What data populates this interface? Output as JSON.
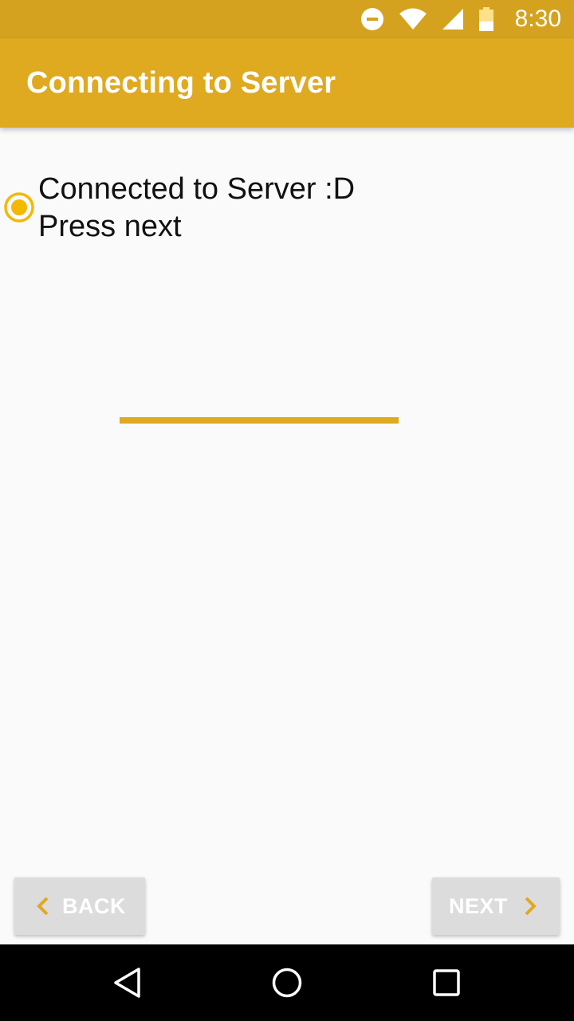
{
  "status_bar": {
    "time": "8:30",
    "icons": [
      "do-not-disturb-icon",
      "wifi-icon",
      "cellular-signal-icon",
      "battery-icon"
    ]
  },
  "app_bar": {
    "title": "Connecting to Server",
    "color": "#dfa920"
  },
  "main": {
    "status_line_1": "Connected to Server :D",
    "status_line_2": "Press next",
    "radio_selected": true,
    "accent_color": "#f5b800"
  },
  "footer": {
    "back_label": "BACK",
    "next_label": "NEXT",
    "back_icon": "chevron-left-icon",
    "next_icon": "chevron-right-icon"
  },
  "nav_bar": {
    "icons": [
      "nav-back-icon",
      "nav-home-icon",
      "nav-recents-icon"
    ]
  }
}
